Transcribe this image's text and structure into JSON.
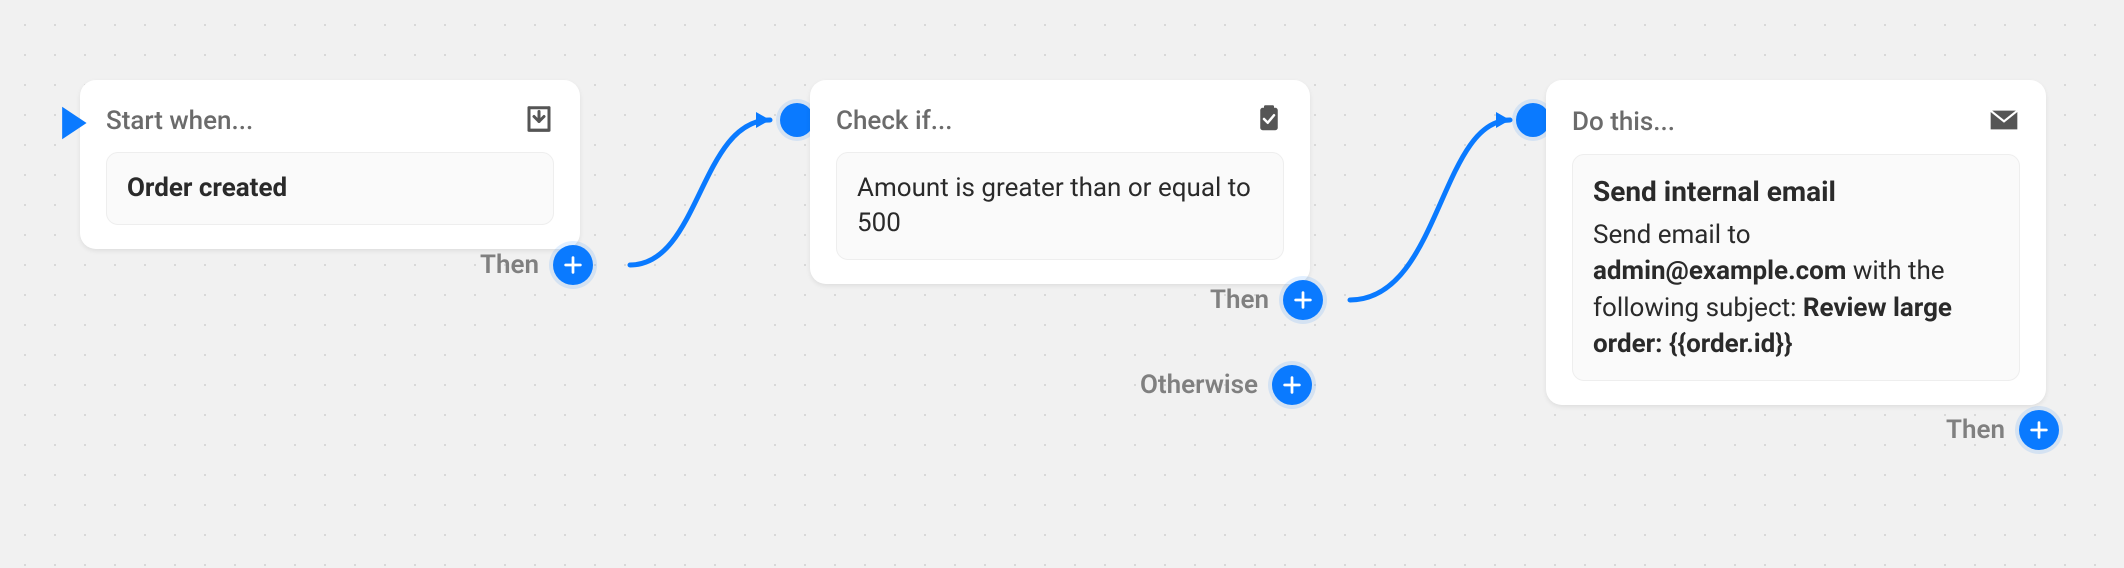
{
  "colors": {
    "accent": "#0a7aff"
  },
  "nodes": {
    "trigger": {
      "header": "Start when...",
      "icon": "download-tray-icon",
      "body": "Order created",
      "outlet_then": "Then"
    },
    "condition": {
      "header": "Check if...",
      "icon": "clipboard-check-icon",
      "body": "Amount is greater than or equal to 500",
      "outlet_then": "Then",
      "outlet_otherwise": "Otherwise"
    },
    "action": {
      "header": "Do this...",
      "icon": "mail-icon",
      "title": "Send internal email",
      "line1_prefix": "Send email to",
      "email": "admin@example.com",
      "line1_suffix": " with the following subject: ",
      "subject": "Review large order: {{order.id}}",
      "outlet_then": "Then"
    }
  }
}
